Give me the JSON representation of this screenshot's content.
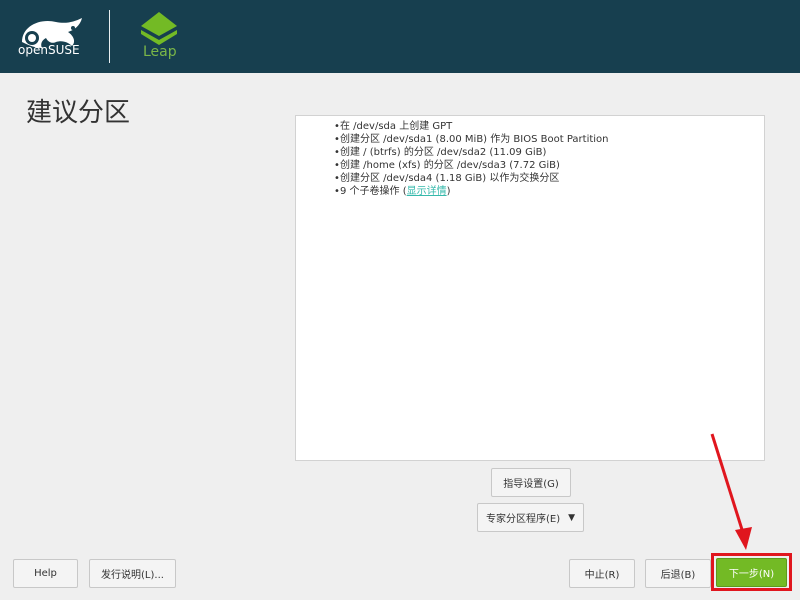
{
  "header": {
    "brand": "openSUSE",
    "product": "Leap"
  },
  "page": {
    "title": "建议分区"
  },
  "summary": {
    "items": [
      "在 /dev/sda 上创建 GPT",
      "创建分区 /dev/sda1 (8.00 MiB) 作为 BIOS Boot Partition",
      "创建 / (btrfs) 的分区 /dev/sda2 (11.09 GiB)",
      "创建 /home (xfs) 的分区 /dev/sda3 (7.72 GiB)",
      "创建分区 /dev/sda4 (1.18 GiB) 以作为交换分区"
    ],
    "subvolume_prefix": "9 个子卷操作 (",
    "show_details": "显示详情",
    "subvolume_suffix": ")"
  },
  "buttons": {
    "guided_setup": "指导设置(G)",
    "expert_partitioner": "专家分区程序(E)",
    "help": "Help",
    "release_notes": "发行说明(L)...",
    "abort": "中止(R)",
    "back": "后退(B)",
    "next": "下一步(N)"
  },
  "colors": {
    "header_bg": "#173f4f",
    "leap_green": "#73ba25",
    "highlight_red": "#e0161e",
    "link": "#35b9ab"
  },
  "icons": [
    "opensuse-chameleon-icon",
    "leap-logo-icon",
    "chevron-down-icon",
    "red-arrow-annotation"
  ]
}
